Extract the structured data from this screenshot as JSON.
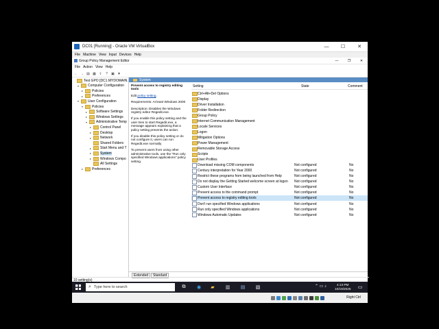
{
  "vbox": {
    "title": "DC01 [Running] - Oracle VM VirtualBox",
    "menu": [
      "File",
      "Machine",
      "View",
      "Input",
      "Devices",
      "Help"
    ],
    "host_key": "Right Ctrl"
  },
  "gpme": {
    "title": "Group Policy Management Editor",
    "menu": [
      "File",
      "Action",
      "View",
      "Help"
    ]
  },
  "tree": [
    {
      "label": "Test GPO [DC1.MYDOMAIN.LO",
      "indent": 0,
      "arrow": ""
    },
    {
      "label": "Computer Configuration",
      "indent": 1,
      "arrow": "v"
    },
    {
      "label": "Policies",
      "indent": 2,
      "arrow": ">"
    },
    {
      "label": "Preferences",
      "indent": 2,
      "arrow": ">"
    },
    {
      "label": "User Configuration",
      "indent": 1,
      "arrow": "v"
    },
    {
      "label": "Policies",
      "indent": 2,
      "arrow": "v"
    },
    {
      "label": "Software Settings",
      "indent": 3,
      "arrow": ">"
    },
    {
      "label": "Windows Settings",
      "indent": 3,
      "arrow": ">"
    },
    {
      "label": "Administrative Temp",
      "indent": 3,
      "arrow": "v"
    },
    {
      "label": "Control Panel",
      "indent": 4,
      "arrow": ">"
    },
    {
      "label": "Desktop",
      "indent": 4,
      "arrow": ">"
    },
    {
      "label": "Network",
      "indent": 4,
      "arrow": ">"
    },
    {
      "label": "Shared Folders",
      "indent": 4,
      "arrow": ""
    },
    {
      "label": "Start Menu and T",
      "indent": 4,
      "arrow": ">"
    },
    {
      "label": "System",
      "indent": 4,
      "arrow": ">",
      "selected": true
    },
    {
      "label": "Windows Compo",
      "indent": 4,
      "arrow": ">"
    },
    {
      "label": "All Settings",
      "indent": 4,
      "arrow": ""
    },
    {
      "label": "Preferences",
      "indent": 2,
      "arrow": ">"
    }
  ],
  "right_header": "System",
  "description": {
    "title": "Prevent access to registry editing tools",
    "edit_prefix": "Edit",
    "edit_link": "policy setting",
    "edit_suffix": ".",
    "requirements": "Requirements: At least Windows 2000",
    "desc": "Description: Disables the Windows registry editor Regedit.exe.",
    "p1": "If you enable this policy setting and the user tries to start Regedit.exe, a message appears explaining that a policy setting prevents the action.",
    "p2": "If you disable this policy setting or do not configure it, users can run Regedit.exe normally.",
    "p3": "To prevent users from using other administrative tools, use the \"Run only specified Windows applications\" policy setting."
  },
  "columns": {
    "setting": "Setting",
    "state": "State",
    "comment": "Comment"
  },
  "rows": [
    {
      "name": "Ctrl+Alt+Del Options",
      "type": "folder",
      "state": "",
      "comment": ""
    },
    {
      "name": "Display",
      "type": "folder",
      "state": "",
      "comment": ""
    },
    {
      "name": "Driver Installation",
      "type": "folder",
      "state": "",
      "comment": ""
    },
    {
      "name": "Folder Redirection",
      "type": "folder",
      "state": "",
      "comment": ""
    },
    {
      "name": "Group Policy",
      "type": "folder",
      "state": "",
      "comment": ""
    },
    {
      "name": "Internet Communication Management",
      "type": "folder",
      "state": "",
      "comment": ""
    },
    {
      "name": "Locale Services",
      "type": "folder",
      "state": "",
      "comment": ""
    },
    {
      "name": "Logon",
      "type": "folder",
      "state": "",
      "comment": ""
    },
    {
      "name": "Mitigation Options",
      "type": "folder",
      "state": "",
      "comment": ""
    },
    {
      "name": "Power Management",
      "type": "folder",
      "state": "",
      "comment": ""
    },
    {
      "name": "Removable Storage Access",
      "type": "folder",
      "state": "",
      "comment": ""
    },
    {
      "name": "Scripts",
      "type": "folder",
      "state": "",
      "comment": ""
    },
    {
      "name": "User Profiles",
      "type": "folder",
      "state": "",
      "comment": ""
    },
    {
      "name": "Download missing COM components",
      "type": "policy",
      "state": "Not configured",
      "comment": "No"
    },
    {
      "name": "Century interpretation for Year 2000",
      "type": "policy",
      "state": "Not configured",
      "comment": "No"
    },
    {
      "name": "Restrict these programs from being launched from Help",
      "type": "policy",
      "state": "Not configured",
      "comment": "No"
    },
    {
      "name": "Do not display the Getting Started welcome screen at logon",
      "type": "policy",
      "state": "Not configured",
      "comment": "No"
    },
    {
      "name": "Custom User Interface",
      "type": "policy",
      "state": "Not configured",
      "comment": "No"
    },
    {
      "name": "Prevent access to the command prompt",
      "type": "policy",
      "state": "Not configured",
      "comment": "No"
    },
    {
      "name": "Prevent access to registry editing tools",
      "type": "policy",
      "state": "Not configured",
      "comment": "No",
      "selected": true
    },
    {
      "name": "Don't run specified Windows applications",
      "type": "policy",
      "state": "Not configured",
      "comment": "No"
    },
    {
      "name": "Run only specified Windows applications",
      "type": "policy",
      "state": "Not configured",
      "comment": "No"
    },
    {
      "name": "Windows Automatic Updates",
      "type": "policy",
      "state": "Not configured",
      "comment": "No"
    }
  ],
  "tabs": [
    "Extended",
    "Standard"
  ],
  "status": "10 setting(s)",
  "taskbar": {
    "search_placeholder": "Type here to search",
    "time": "4:13 PM",
    "date": "10/19/2025"
  }
}
